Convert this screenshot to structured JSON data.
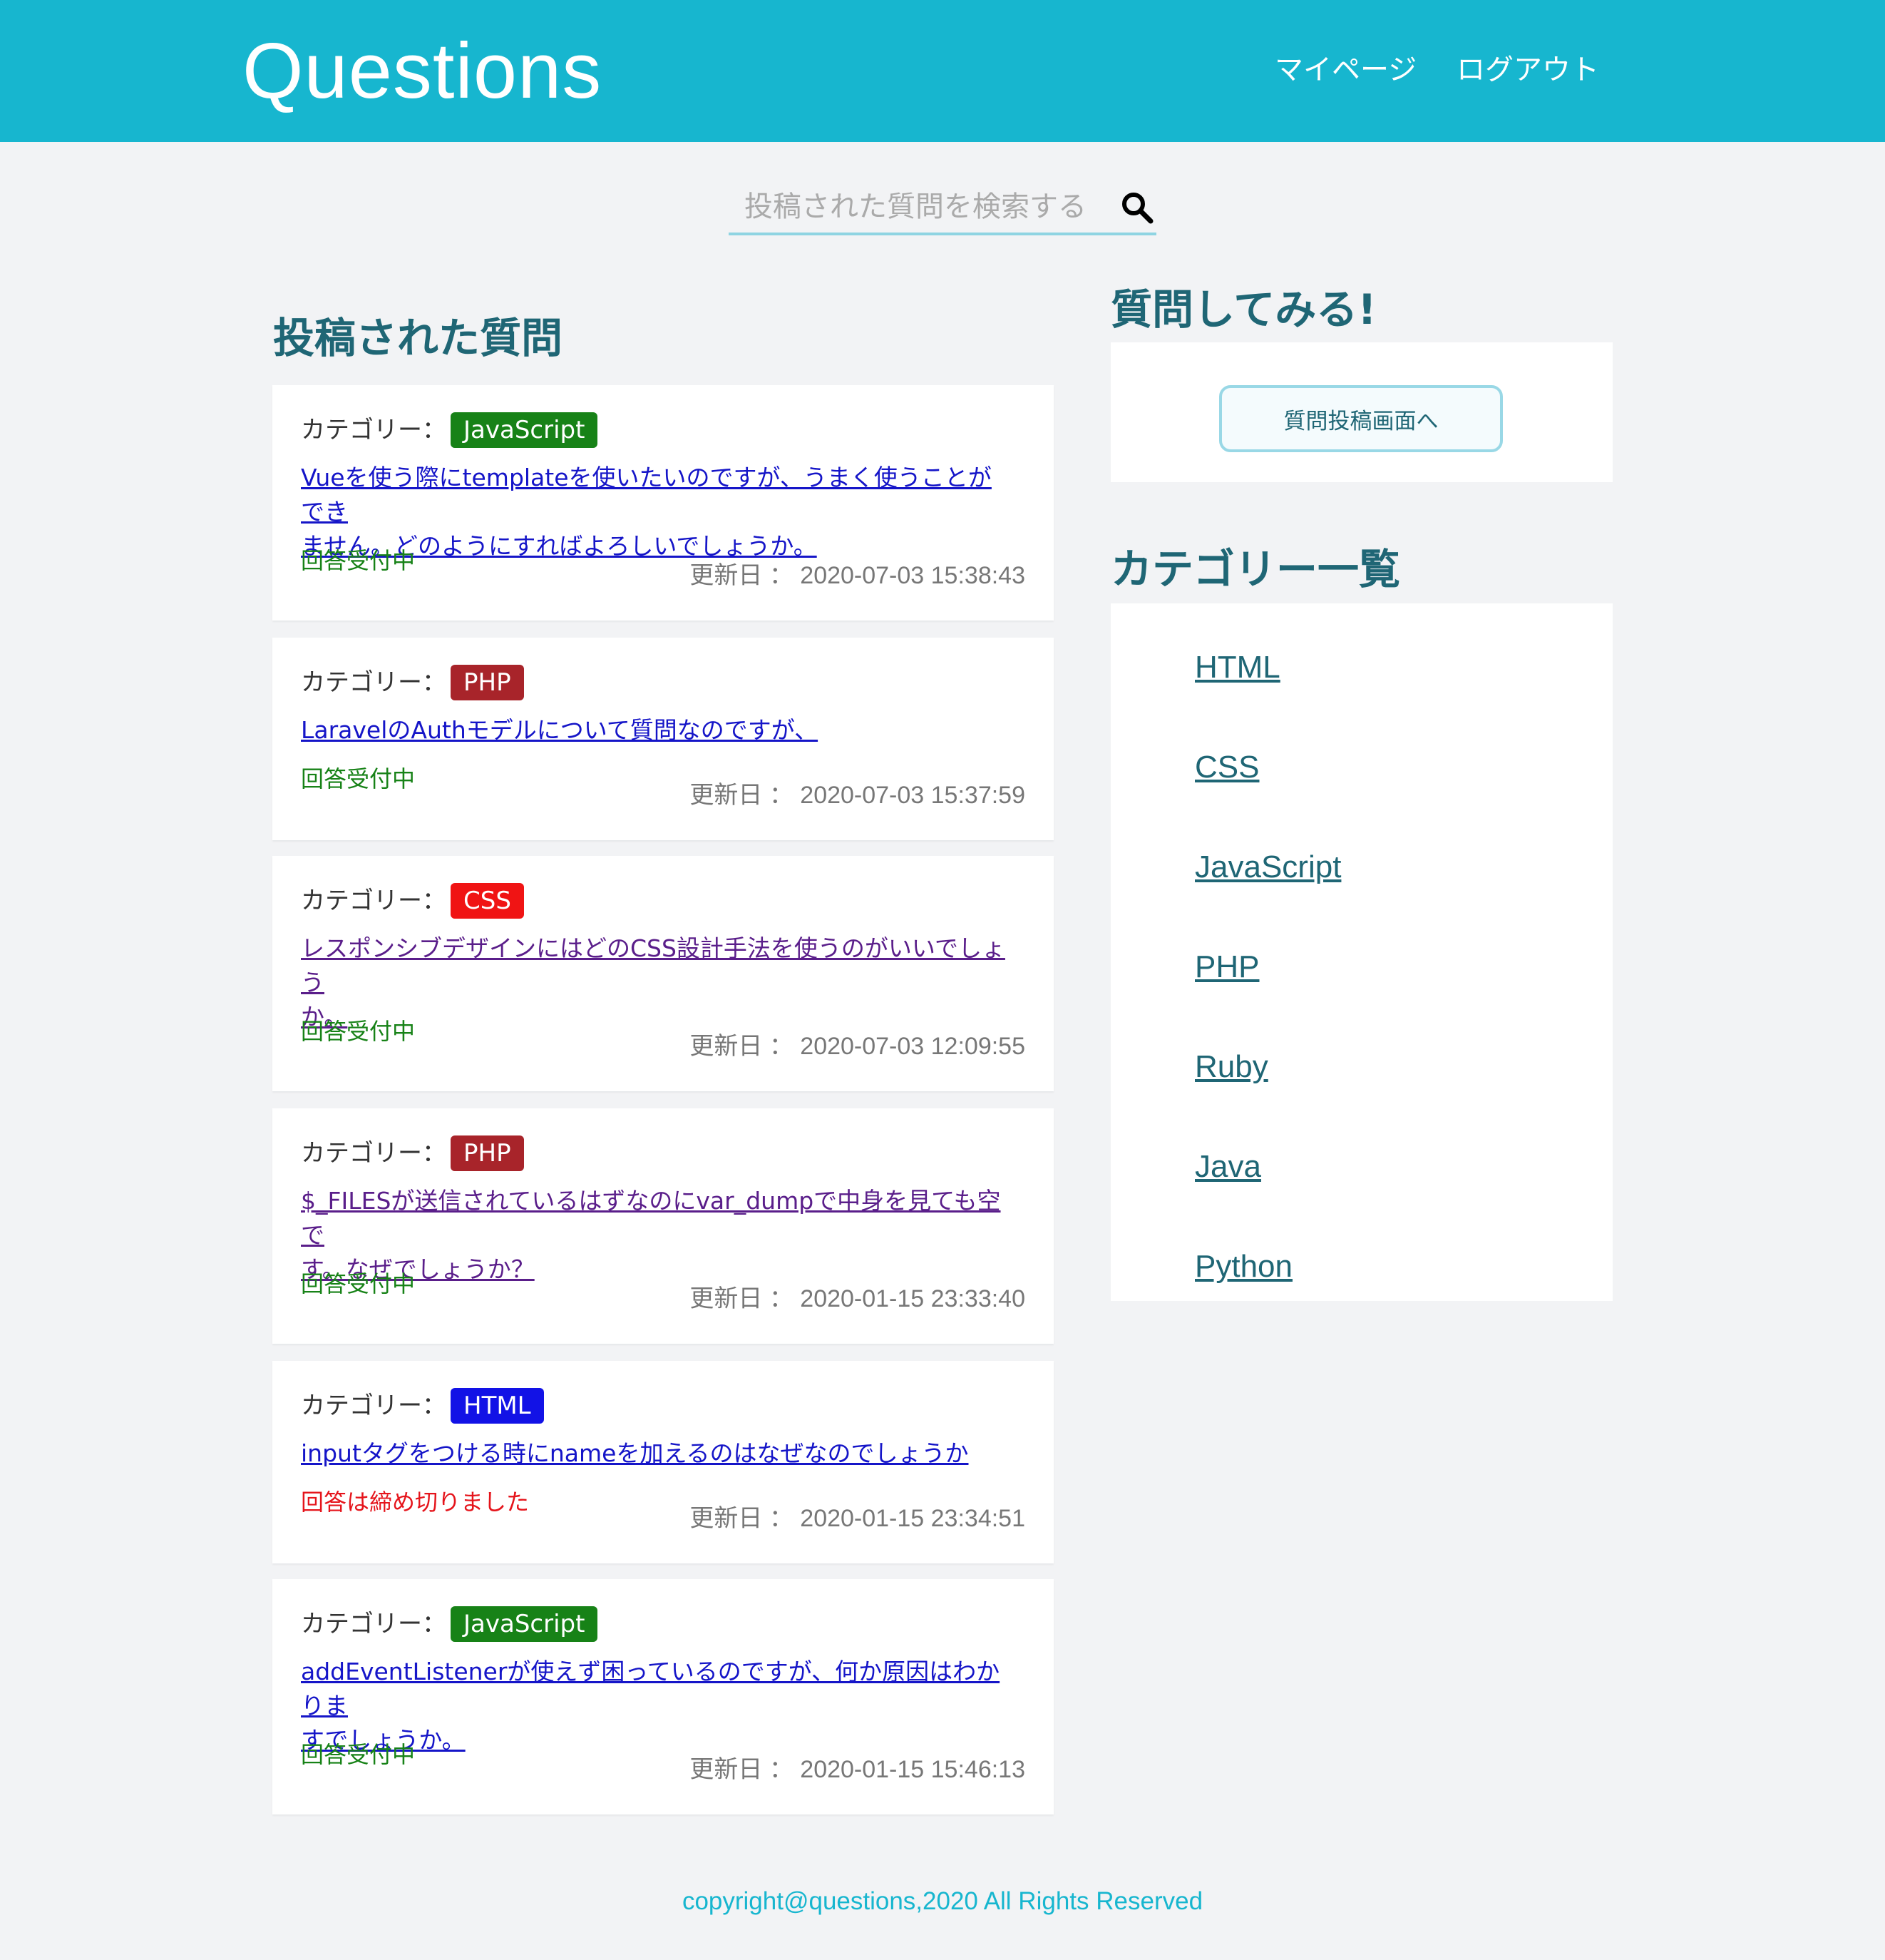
{
  "header": {
    "brand": "Questions",
    "nav_mypage": "マイページ",
    "nav_logout": "ログアウト"
  },
  "search": {
    "placeholder": "投稿された質問を検索する",
    "icon": "search-icon"
  },
  "main": {
    "title": "投稿された質問",
    "category_label": "カテゴリー：",
    "updated_label": "更新日 ：",
    "questions": [
      {
        "category": "JavaScript",
        "category_color": "#178217",
        "title_line1": "Vueを使う際にtemplateを使いたいのですが、うまく使うことができ",
        "title_line2": "ません。どのようにすればよろしいでしょうか。",
        "status": "回答受付中",
        "date": "2020-07-03 15:38:43"
      },
      {
        "category": "PHP",
        "category_color": "#a8242a",
        "title_line1": "LaravelのAuthモデルについて質問なのですが、",
        "title_line2": "",
        "status": "回答受付中",
        "date": "2020-07-03 15:37:59"
      },
      {
        "category": "CSS",
        "category_color": "#f01414",
        "title_line1": "レスポンシブデザインにはどのCSS設計手法を使うのがいいでしょう",
        "title_line2": "か。",
        "status": "回答受付中",
        "date": "2020-07-03 12:09:55"
      },
      {
        "category": "PHP",
        "category_color": "#a8242a",
        "title_line1": "$_FILESが送信されているはずなのにvar_dumpで中身を見ても空で",
        "title_line2": "す。なぜでしょうか？",
        "status": "回答受付中",
        "date": "2020-01-15 23:33:40"
      },
      {
        "category": "HTML",
        "category_color": "#1212e6",
        "title_line1": "inputタグをつける時にnameを加えるのはなぜなのでしょうか",
        "title_line2": "",
        "status": "回答は締め切りました",
        "date": "2020-01-15 23:34:51"
      },
      {
        "category": "JavaScript",
        "category_color": "#178217",
        "title_line1": "addEventListenerが使えず困っているのですが、何か原因はわかりま",
        "title_line2": "すでしょうか。",
        "status": "回答受付中",
        "date": "2020-01-15 15:46:13"
      }
    ]
  },
  "sidebar": {
    "ask_title": "質問してみる!",
    "ask_button": "質問投稿画面へ",
    "categories_title": "カテゴリー一覧",
    "categories": [
      "HTML",
      "CSS",
      "JavaScript",
      "PHP",
      "Ruby",
      "Java",
      "Python"
    ]
  },
  "footer": {
    "copyright": "copyright@questions,2020 All Rights Reserved"
  },
  "colors": {
    "header_bg": "#17b6cf",
    "heading": "#1f6675",
    "status_open": "#178217",
    "status_closed": "#e5141b"
  }
}
